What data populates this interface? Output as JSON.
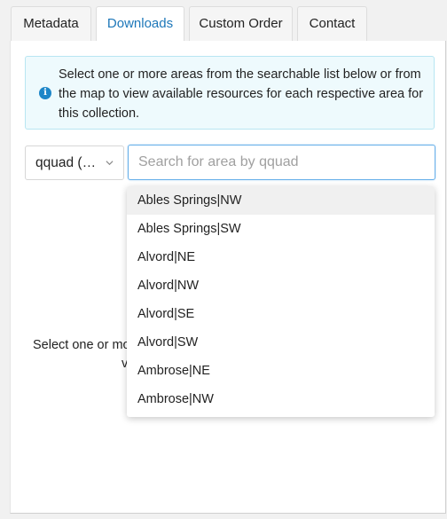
{
  "tabs": [
    {
      "label": "Metadata",
      "active": false
    },
    {
      "label": "Downloads",
      "active": true
    },
    {
      "label": "Custom Order",
      "active": false
    },
    {
      "label": "Contact",
      "active": false
    }
  ],
  "info": {
    "icon": "info-icon",
    "text": "Select one or more areas from the searchable list below or from the map to view available resources for each respective area for this collection."
  },
  "area_type_select": {
    "value": "qquad (…"
  },
  "search": {
    "placeholder": "Search for area by qquad",
    "value": ""
  },
  "dropdown": {
    "items": [
      "Ables Springs|NW",
      "Ables Springs|SW",
      "Alvord|NE",
      "Alvord|NW",
      "Alvord|SE",
      "Alvord|SW",
      "Ambrose|NE",
      "Ambrose|NW"
    ]
  },
  "background_message": {
    "line1": "Select one or mo",
    "line2": "v"
  },
  "colors": {
    "accent": "#1d77b9",
    "focus_border": "#66afe9",
    "info_bg": "#eefafd",
    "info_border": "#b8e6f2"
  }
}
